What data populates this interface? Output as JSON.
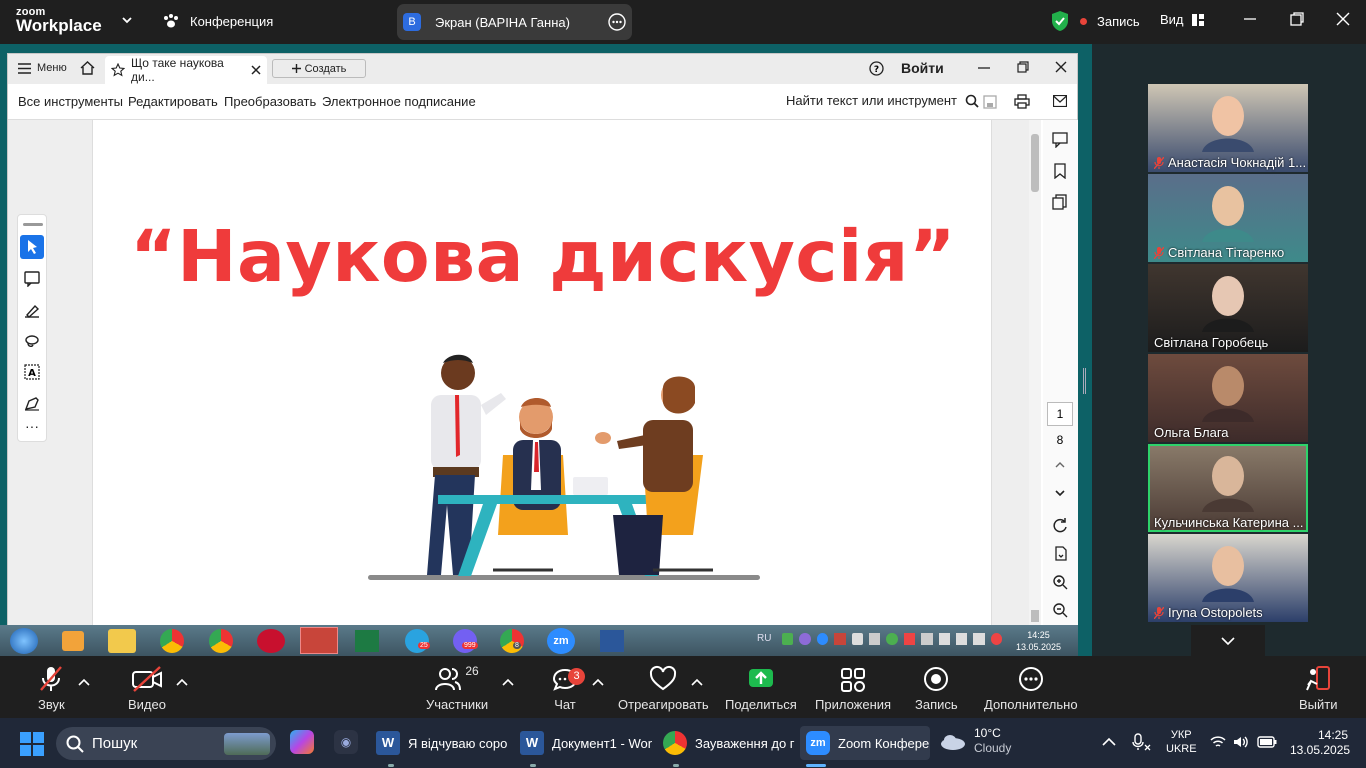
{
  "zoom_top": {
    "logo_line1": "zoom",
    "logo_line2": "Workplace",
    "meeting_label": "Конференция",
    "screen_badge": "B",
    "screen_label": "Экран (ВАРІНА Ганна)",
    "record_label": "Запись",
    "view_label": "Вид"
  },
  "acrobat": {
    "menu_label": "Меню",
    "tab_title": "Що таке наукова ди...",
    "create_label": "Создать",
    "signin_label": "Войти",
    "toolbar": [
      "Все инструменты",
      "Редактировать",
      "Преобразовать",
      "Электронное подписание"
    ],
    "search_label": "Найти текст или инструмент",
    "page_current": "1",
    "page_total": "8",
    "slide_title": "“Наукова дискусія”"
  },
  "w7_taskbar": {
    "lang": "RU",
    "time": "14:25",
    "date": "13.05.2025",
    "badge_telegram": "25",
    "badge_viber": "999",
    "badge_chrome": "8"
  },
  "gallery": [
    {
      "name": "Анастасія Чокнадій 1...",
      "muted": true
    },
    {
      "name": "Світлана Тітаренко",
      "muted": true
    },
    {
      "name": "Світлана Горобець",
      "muted": false
    },
    {
      "name": "Ольга Блага",
      "muted": false
    },
    {
      "name": "Кульчинська Катерина ...",
      "muted": false,
      "active": true
    },
    {
      "name": "Iryna Ostopolets",
      "muted": true
    }
  ],
  "zoom_bottom": {
    "audio": "Звук",
    "video": "Видео",
    "participants": "Участники",
    "participants_count": "26",
    "chat": "Чат",
    "chat_badge": "3",
    "react": "Отреагировать",
    "share": "Поделиться",
    "apps": "Приложения",
    "record": "Запись",
    "more": "Дополнительно",
    "leave": "Выйти"
  },
  "win11": {
    "search": "Пошук",
    "apps": [
      "Я відчуваю соро",
      "Документ1 - Wor",
      "Зауваження до г",
      "Zoom Конфере"
    ],
    "weather_temp": "10°C",
    "weather_desc": "Cloudy",
    "lang1": "УКР",
    "lang2": "UKRE",
    "time": "14:25",
    "date": "13.05.2025"
  },
  "colors": {
    "title_red": "#ef3b3b",
    "zoom_dark": "#1f1f1f",
    "share_green": "#1dba4e",
    "active_border": "#2ed36a",
    "teal_bg": "#0d6166"
  }
}
